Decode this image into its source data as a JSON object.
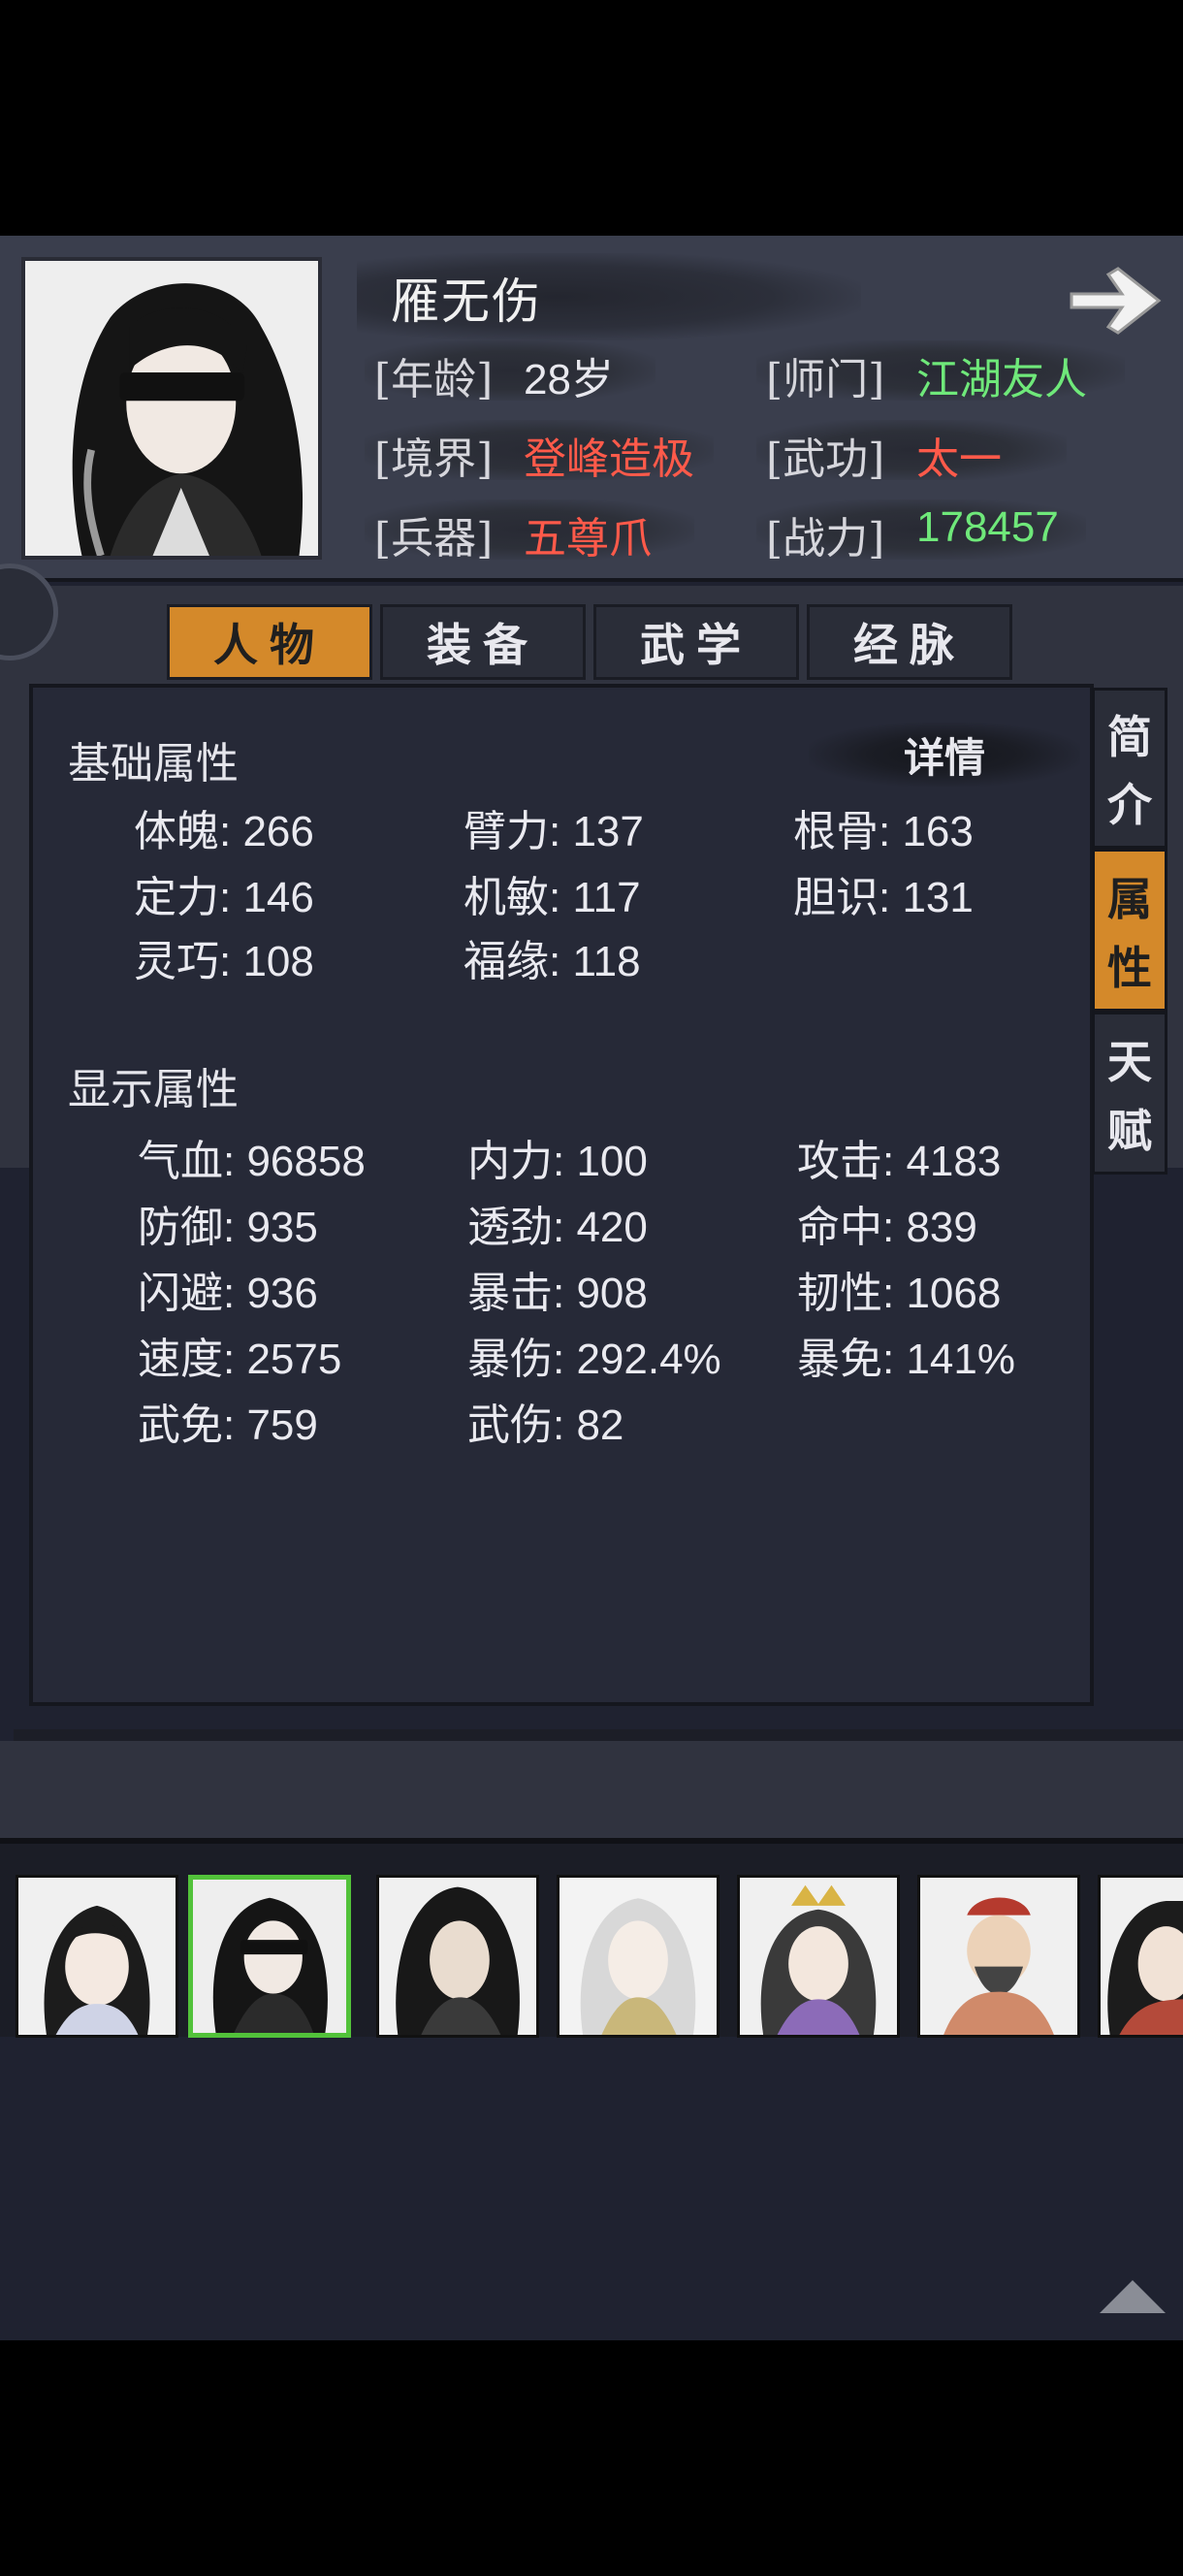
{
  "character": {
    "name": "雁无伤",
    "age_label": "[年龄]",
    "age_value": "28岁",
    "sect_label": "[师门]",
    "sect_value": "江湖友人",
    "realm_label": "[境界]",
    "realm_value": "登峰造极",
    "skill_label": "[武功]",
    "skill_value": "太一",
    "weapon_label": "[兵器]",
    "weapon_value": "五尊爪",
    "power_label": "[战力]",
    "power_value": "178457"
  },
  "tabs": [
    "人物",
    "装备",
    "武学",
    "经脉"
  ],
  "active_tab": "人物",
  "side_tabs": [
    [
      "简",
      "介"
    ],
    [
      "属",
      "性"
    ],
    [
      "天",
      "赋"
    ]
  ],
  "active_side_tab": "属性",
  "basic": {
    "title": "基础属性",
    "detail_button": "详情",
    "stats": [
      "体魄: 266",
      "臂力: 137",
      "根骨: 163",
      "定力: 146",
      "机敏: 117",
      "胆识: 131",
      "灵巧: 108",
      "福缘: 118"
    ]
  },
  "display": {
    "title": "显示属性",
    "stats": [
      "气血: 96858",
      "内力: 100",
      "攻击: 4183",
      "防御: 935",
      "透劲: 420",
      "命中: 839",
      "闪避: 936",
      "暴击: 908",
      "韧性: 1068",
      "速度: 2575",
      "暴伤: 292.4%",
      "暴免: 141%",
      "武免: 759",
      "武伤: 82"
    ]
  },
  "roster": {
    "selected_index": 1,
    "icons": [
      "portrait-female-icon",
      "portrait-blindfold-icon",
      "portrait-swordsman-icon",
      "portrait-white-hair-icon",
      "portrait-crowned-female-icon",
      "portrait-bearded-man-icon",
      "portrait-partial-icon"
    ]
  },
  "colors": {
    "accent_orange": "#d4892a",
    "value_red": "#ff5a4a",
    "value_green": "#6fe87a",
    "selected_border": "#52c23a"
  }
}
